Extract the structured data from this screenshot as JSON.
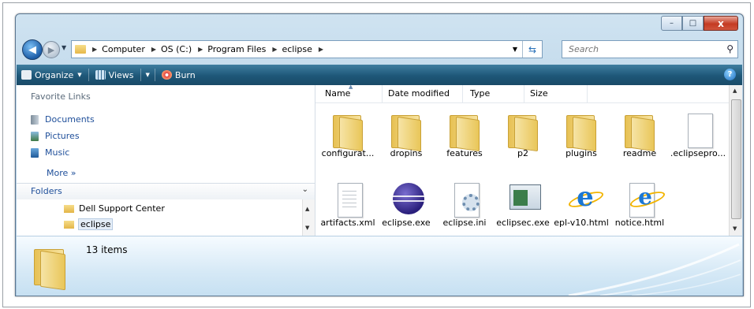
{
  "window": {
    "controls": {
      "minimize": "–",
      "maximize": "□",
      "close": "x"
    }
  },
  "nav": {
    "back_glyph": "◀",
    "forward_glyph": "▶"
  },
  "address": {
    "crumbs": [
      "Computer",
      "OS (C:)",
      "Program Files",
      "eclipse"
    ],
    "separator": "▶"
  },
  "search": {
    "placeholder": "Search"
  },
  "toolbar": {
    "organize": "Organize",
    "views": "Views",
    "burn": "Burn",
    "help": "?"
  },
  "favorites": {
    "title": "Favorite Links",
    "links": [
      "Documents",
      "Pictures",
      "Music"
    ],
    "more": "More  »"
  },
  "folders": {
    "title": "Folders",
    "items": [
      "Dell Support Center",
      "eclipse"
    ]
  },
  "columns": [
    "Name",
    "Date modified",
    "Type",
    "Size"
  ],
  "files": [
    {
      "name": "configurat...",
      "icon": "folder-icon"
    },
    {
      "name": "dropins",
      "icon": "folder-icon"
    },
    {
      "name": "features",
      "icon": "folder-icon"
    },
    {
      "name": "p2",
      "icon": "folder-icon"
    },
    {
      "name": "plugins",
      "icon": "folder-icon"
    },
    {
      "name": "readme",
      "icon": "folder-icon"
    },
    {
      "name": ".eclipsepro...",
      "icon": "document-icon"
    },
    {
      "name": "artifacts.xml",
      "icon": "document-icon"
    },
    {
      "name": "eclipse.exe",
      "icon": "eclipse-icon"
    },
    {
      "name": "eclipse.ini",
      "icon": "settings-document-icon"
    },
    {
      "name": "eclipsec.exe",
      "icon": "application-icon"
    },
    {
      "name": "epl-v10.html",
      "icon": "ie-document-icon"
    },
    {
      "name": "notice.html",
      "icon": "ie-document-icon"
    }
  ],
  "details": {
    "count": "13 items"
  },
  "colors": {
    "toolbar": "#1e5778",
    "link": "#1f4f9a",
    "close": "#c43a22"
  }
}
